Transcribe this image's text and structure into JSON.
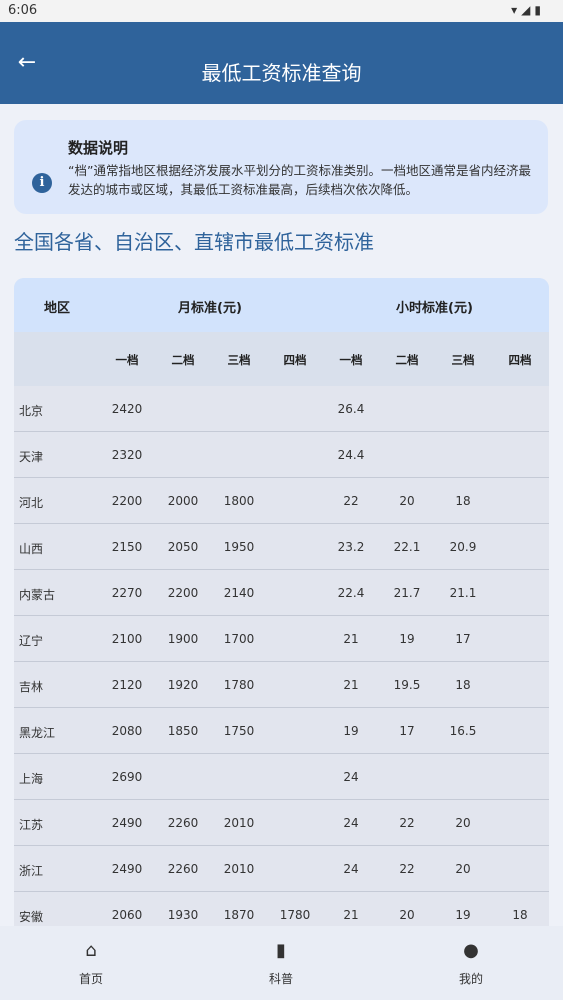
{
  "status": {
    "time": "6:06"
  },
  "appbar": {
    "title": "最低工资标准查询"
  },
  "note": {
    "title": "数据说明",
    "text": "“档”通常指地区根据经济发展水平划分的工资标准类别。一档地区通常是省内经济最发达的城市或区域，其最低工资标准最高，后续档次依次降低。"
  },
  "section_title": "全国各省、自治区、直辖市最低工资标准",
  "table": {
    "header_region": "地区",
    "header_month": "月标准(元)",
    "header_hour": "小时标准(元)",
    "tiers": [
      "一档",
      "二档",
      "三档",
      "四档",
      "一档",
      "二档",
      "三档",
      "四档"
    ],
    "rows": [
      {
        "name": "北京",
        "cells": [
          "2420",
          "",
          "",
          "",
          "26.4",
          "",
          "",
          ""
        ]
      },
      {
        "name": "天津",
        "cells": [
          "2320",
          "",
          "",
          "",
          "24.4",
          "",
          "",
          ""
        ]
      },
      {
        "name": "河北",
        "cells": [
          "2200",
          "2000",
          "1800",
          "",
          "22",
          "20",
          "18",
          ""
        ]
      },
      {
        "name": "山西",
        "cells": [
          "2150",
          "2050",
          "1950",
          "",
          "23.2",
          "22.1",
          "20.9",
          ""
        ]
      },
      {
        "name": "内蒙古",
        "cells": [
          "2270",
          "2200",
          "2140",
          "",
          "22.4",
          "21.7",
          "21.1",
          ""
        ]
      },
      {
        "name": "辽宁",
        "cells": [
          "2100",
          "1900",
          "1700",
          "",
          "21",
          "19",
          "17",
          ""
        ]
      },
      {
        "name": "吉林",
        "cells": [
          "2120",
          "1920",
          "1780",
          "",
          "21",
          "19.5",
          "18",
          ""
        ]
      },
      {
        "name": "黑龙江",
        "cells": [
          "2080",
          "1850",
          "1750",
          "",
          "19",
          "17",
          "16.5",
          ""
        ]
      },
      {
        "name": "上海",
        "cells": [
          "2690",
          "",
          "",
          "",
          "24",
          "",
          "",
          ""
        ]
      },
      {
        "name": "江苏",
        "cells": [
          "2490",
          "2260",
          "2010",
          "",
          "24",
          "22",
          "20",
          ""
        ]
      },
      {
        "name": "浙江",
        "cells": [
          "2490",
          "2260",
          "2010",
          "",
          "24",
          "22",
          "20",
          ""
        ]
      },
      {
        "name": "安徽",
        "cells": [
          "2060",
          "1930",
          "1870",
          "1780",
          "21",
          "20",
          "19",
          "18"
        ]
      }
    ]
  },
  "nav": [
    {
      "label": "首页",
      "icon": "home-icon"
    },
    {
      "label": "科普",
      "icon": "book-icon"
    },
    {
      "label": "我的",
      "icon": "person-icon"
    }
  ]
}
